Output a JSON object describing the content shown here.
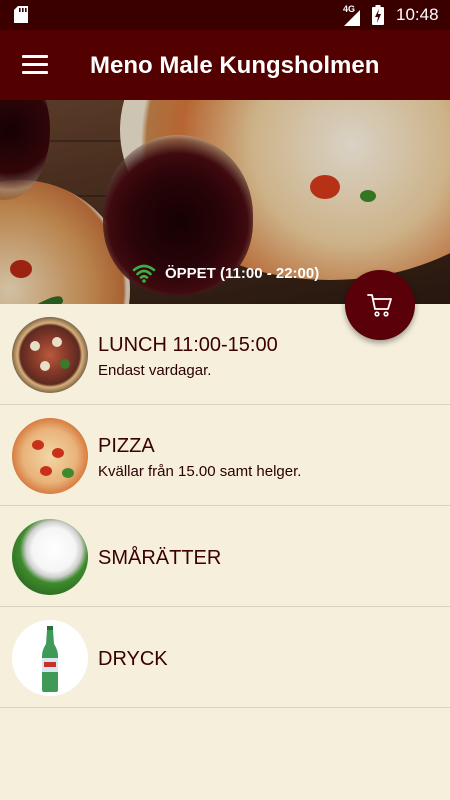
{
  "status_bar": {
    "network": "4G",
    "time": "10:48"
  },
  "app_bar": {
    "title": "Meno Male Kungsholmen"
  },
  "hero": {
    "open_status": "ÖPPET (11:00 - 22:00)",
    "status_icon_color": "#3cb043"
  },
  "menu": {
    "items": [
      {
        "title": "LUNCH 11:00-15:00",
        "subtitle": "Endast vardagar."
      },
      {
        "title": "PIZZA",
        "subtitle": "Kvällar från 15.00 samt helger."
      },
      {
        "title": "SMÅRÄTTER"
      },
      {
        "title": "DRYCK"
      }
    ]
  },
  "colors": {
    "app_bar": "#520000",
    "status_bar": "#3a0000",
    "background": "#f5efdc",
    "text": "#3b0000",
    "cart_button": "#5a0008"
  },
  "icons": {
    "menu": "hamburger-menu-icon",
    "cart": "shopping-cart-icon",
    "open": "wifi-icon"
  }
}
